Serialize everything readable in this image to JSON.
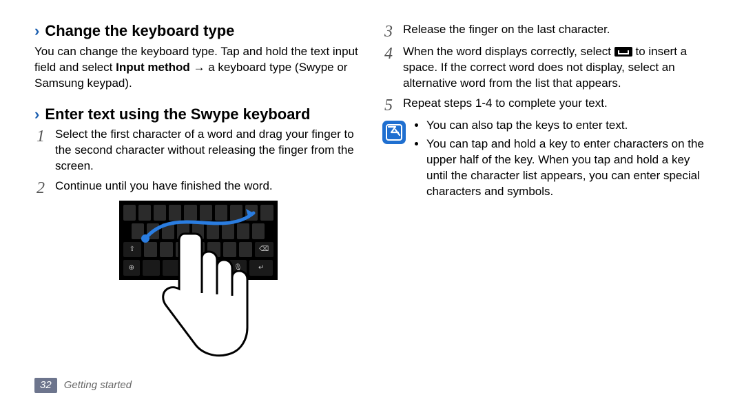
{
  "left": {
    "section1": {
      "title": "Change the keyboard type",
      "body_pre": "You can change the keyboard type. Tap and hold the text input field and select ",
      "body_bold": "Input method",
      "body_post": " → a keyboard type (Swype or Samsung keypad)."
    },
    "section2": {
      "title": "Enter text using the Swype keyboard",
      "step1": "Select the first character of a word and drag your finger to the second character without releasing the finger from the screen.",
      "step2": "Continue until you have finished the word."
    }
  },
  "right": {
    "step3": "Release the finger on the last character.",
    "step4_pre": "When the word displays correctly, select ",
    "step4_post": " to insert a space. If the correct word does not display, select an alternative word from the list that appears.",
    "step5": "Repeat steps 1-4 to complete your text.",
    "note1": "You can also tap the keys to enter text.",
    "note2": "You can tap and hold a key to enter characters on the upper half of the key. When you tap and hold a key until the character list appears, you can enter special characters and symbols."
  },
  "footer": {
    "page": "32",
    "section": "Getting started"
  },
  "icons": {
    "shift": "⇧",
    "globe": "⊕",
    "mic": "🎤",
    "enter": "↵",
    "bksp": "⌫"
  }
}
